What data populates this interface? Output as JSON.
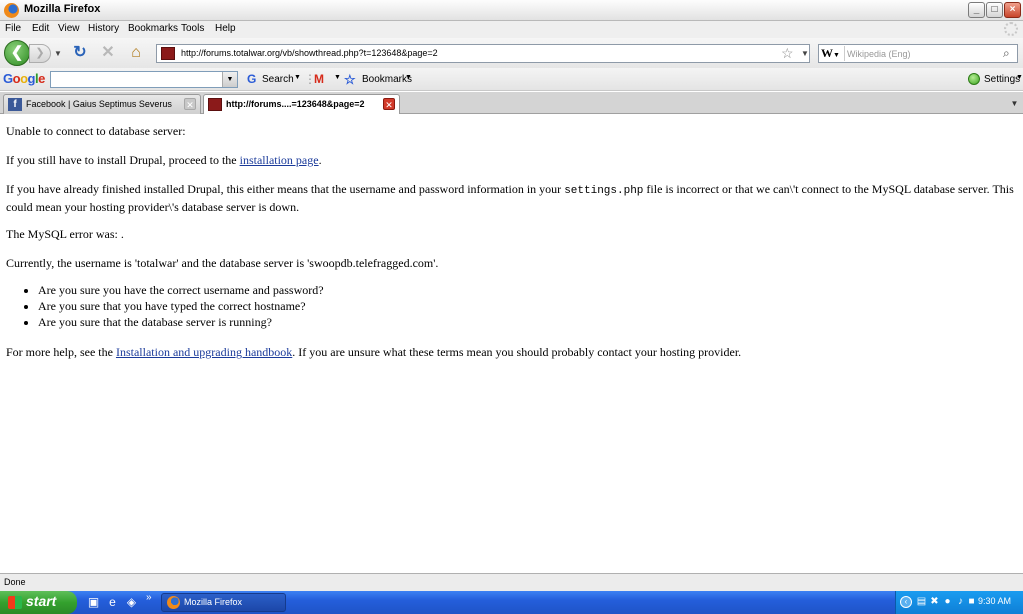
{
  "window": {
    "title": "Mozilla Firefox",
    "controls": {
      "minimize": "_",
      "maximize": "□",
      "close": "×"
    }
  },
  "menu": [
    "File",
    "Edit",
    "View",
    "History",
    "Bookmarks",
    "Tools",
    "Help"
  ],
  "nav": {
    "url": "http://forums.totalwar.org/vb/showthread.php?t=123648&page=2",
    "search_placeholder": "Wikipedia (Eng)",
    "search_engine": "W"
  },
  "google_toolbar": {
    "logo": [
      "G",
      "o",
      "o",
      "g",
      "l",
      "e"
    ],
    "search_button": "Search",
    "bookmarks_label": "Bookmarks",
    "settings_label": "Settings"
  },
  "tabs": [
    {
      "label": "Facebook | Gaius Septimus Severus",
      "active": false
    },
    {
      "label": "http://forums....=123648&page=2",
      "active": true
    }
  ],
  "content": {
    "line1": "Unable to connect to database server:",
    "install_prefix": "If you still have to install Drupal, proceed to the ",
    "install_link": "installation page",
    "install_suffix": ".",
    "settings_prefix": "If you have already finished installed Drupal, this either means that the username and password information in your ",
    "settings_code": "settings.php",
    "settings_suffix": " file is incorrect or that we can\\'t connect to the MySQL database server. This could mean your hosting provider\\'s database server is down.",
    "mysql_error": "The MySQL error was: .",
    "currently": "Currently, the username is 'totalwar' and the database server is 'swoopdb.telefragged.com'.",
    "checks": [
      "Are you sure you have the correct username and password?",
      "Are you sure that you have typed the correct hostname?",
      "Are you sure that the database server is running?"
    ],
    "help_prefix": "For more help, see the ",
    "help_link": "Installation and upgrading handbook",
    "help_suffix": ". If you are unsure what these terms mean you should probably contact your hosting provider."
  },
  "status": "Done",
  "taskbar": {
    "start": "start",
    "task_label": "Mozilla Firefox",
    "clock": "9:30 AM"
  }
}
